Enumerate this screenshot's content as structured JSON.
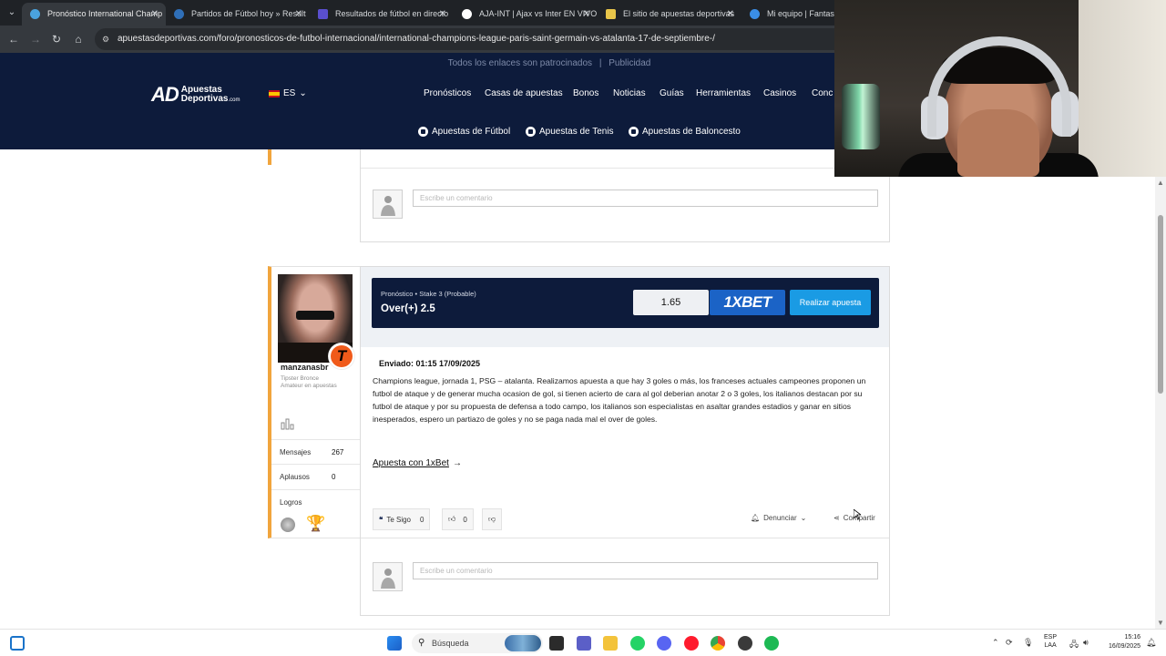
{
  "browser": {
    "tabs": [
      {
        "title": "Pronóstico International Champ",
        "active": true
      },
      {
        "title": "Partidos de Fútbol hoy » Result"
      },
      {
        "title": "Resultados de fútbol en directo"
      },
      {
        "title": "AJA-INT | Ajax vs Inter EN VIVO"
      },
      {
        "title": "El sitio de apuestas deportivas"
      },
      {
        "title": "Mi equipo | Fantasy F"
      }
    ],
    "url": "apuestasdeportivas.com/foro/pronosticos-de-futbol-internacional/international-champions-league-paris-saint-germain-vs-atalanta-17-de-septiembre-/"
  },
  "site": {
    "sponsor_note": "Todos los enlaces son patrocinados",
    "separator": "|",
    "advertising": "Publicidad",
    "logo_mark": "AD",
    "logo_line1": "Apuestas",
    "logo_line2": "Deportivas",
    "logo_suffix": ".com",
    "language": "ES",
    "nav": [
      "Pronósticos",
      "Casas de apuestas",
      "Bonos",
      "Noticias",
      "Guías",
      "Herramientas",
      "Casinos",
      "Conc"
    ],
    "sub_nav": [
      "Apuestas de Fútbol",
      "Apuestas de Tenis",
      "Apuestas de Baloncesto"
    ]
  },
  "comment_placeholder": "Escribe un comentario",
  "post": {
    "username": "manzanasbr",
    "rank": "Tipster Bronce",
    "level": "Amateur en apuestas",
    "badge_letter": "T",
    "stats": [
      {
        "label": "Mensajes",
        "value": "267"
      },
      {
        "label": "Aplausos",
        "value": "0"
      }
    ],
    "achievements_label": "Logros",
    "bet": {
      "meta": "Pronóstico • Stake 3 (Probable)",
      "pick": "Over(+) 2.5",
      "odds": "1.65",
      "bookmaker": "1XBET",
      "cta": "Realizar apuesta"
    },
    "sent": "Enviado: 01:15 17/09/2025",
    "body": "Champions league, jornada 1, PSG – atalanta. Realizamos apuesta a que hay 3 goles o más, los franceses actuales campeones proponen un futbol de ataque y de generar mucha ocasion de gol, si tienen acierto de cara al gol deberian anotar 2 o 3 goles, los italianos destacan por su futbol de ataque y por su propuesta de defensa a todo campo, los italianos son especialistas en asaltar grandes estadios y ganar en sitios inesperados, espero un partiazo de goles y no se paga nada mal el over de goles.",
    "link": "Apuesta con 1xBet",
    "follow_label": "Te Sigo",
    "follow_count": "0",
    "likes": "0",
    "report": "Denunciar",
    "share": "Compartir"
  },
  "taskbar": {
    "search": "Búsqueda",
    "lang_line1": "ESP",
    "lang_line2": "LAA",
    "time": "15:16",
    "date": "16/09/2025"
  }
}
